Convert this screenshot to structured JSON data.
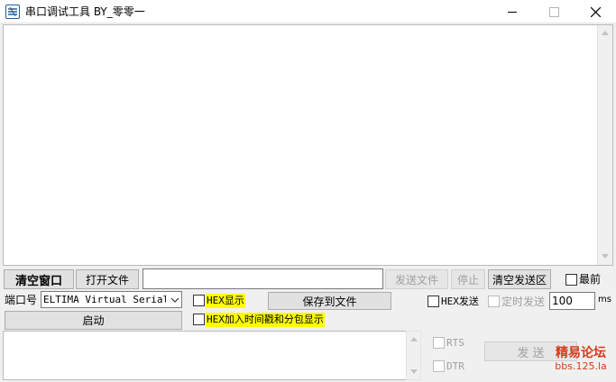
{
  "window": {
    "title": "串口调试工具 BY_零零一"
  },
  "toolbar": {
    "clear_window_label": "清空窗口",
    "open_file_label": "打开文件",
    "file_path_value": "",
    "send_file_label": "发送文件",
    "stop_label": "停止",
    "clear_send_label": "清空发送区",
    "topmost_label": "最前"
  },
  "serial": {
    "port_label": "端口号",
    "port_selected": "ELTIMA Virtual Serial Port",
    "start_label": "启动"
  },
  "options": {
    "hex_display_label": "HEX显示",
    "save_to_file_label": "保存到文件",
    "hex_send_label": "HEX发送",
    "timed_send_label": "定时发送",
    "interval_value": "100",
    "interval_unit": "ms",
    "hex_timestamp_label": "HEX加入时间戳和分包显示"
  },
  "signals": {
    "rts_label": "RTS",
    "dtr_label": "DTR",
    "send_label": "发 送"
  },
  "watermark": {
    "line1": "精易论坛",
    "line2": "bbs.125.la"
  }
}
